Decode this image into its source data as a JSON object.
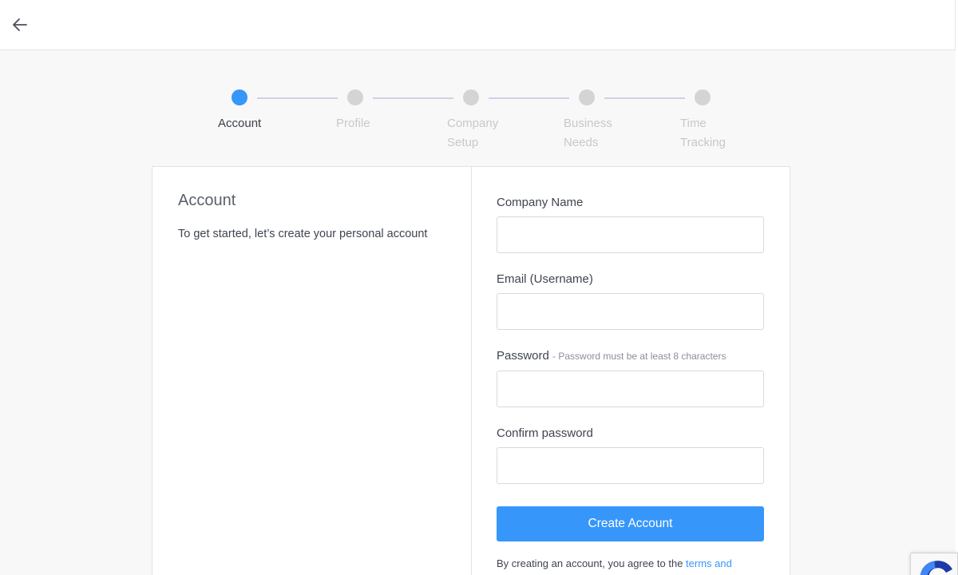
{
  "header": {
    "back_icon": "arrow-left-icon"
  },
  "stepper": {
    "steps": [
      {
        "label": "Account",
        "active": true
      },
      {
        "label": "Profile",
        "active": false
      },
      {
        "label": "Company\nSetup",
        "active": false
      },
      {
        "label": "Business\nNeeds",
        "active": false
      },
      {
        "label": "Time\nTracking",
        "active": false
      }
    ]
  },
  "left_panel": {
    "title": "Account",
    "description": "To get started, let’s create your personal account"
  },
  "form": {
    "company_name_label": "Company Name",
    "email_label": "Email (Username)",
    "password_label": "Password",
    "password_hint": "- Password must be at least 8 characters",
    "confirm_password_label": "Confirm password",
    "company_name_value": "",
    "email_value": "",
    "password_value": "",
    "confirm_password_value": "",
    "submit_label": "Create Account",
    "terms_prefix": "By creating an account, you agree to the ",
    "terms_link": "terms and"
  },
  "colors": {
    "accent": "#3696fa",
    "inactive_step": "#d4d4d4",
    "connector": "#cfd1e8"
  },
  "recaptcha_icon": "recaptcha-icon"
}
